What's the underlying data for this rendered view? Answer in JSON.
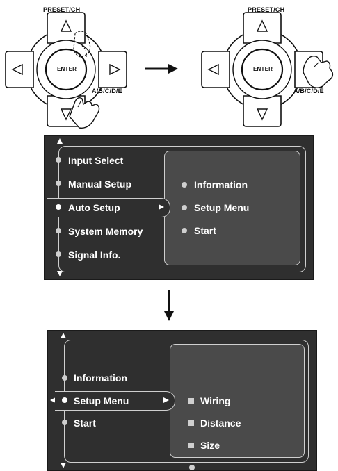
{
  "remote": {
    "preset_label": "PRESET/CH",
    "enter_label": "ENTER",
    "abcde_label": "A/B/C/D/E"
  },
  "screen1": {
    "menu": [
      {
        "label": "Input Select"
      },
      {
        "label": "Manual Setup"
      },
      {
        "label": "Auto Setup"
      },
      {
        "label": "System Memory"
      },
      {
        "label": "Signal Info."
      }
    ],
    "submenu": [
      {
        "label": "Information"
      },
      {
        "label": "Setup Menu"
      },
      {
        "label": "Start"
      }
    ]
  },
  "screen2": {
    "menu": [
      {
        "label": "Information"
      },
      {
        "label": "Setup Menu"
      },
      {
        "label": "Start"
      }
    ],
    "submenu": [
      {
        "label": "Wiring"
      },
      {
        "label": "Distance"
      },
      {
        "label": "Size"
      }
    ]
  },
  "colors": {
    "osd_background": "#2f2f2f",
    "osd_sub_background": "#4a4a4a",
    "text": "#ffffff"
  }
}
